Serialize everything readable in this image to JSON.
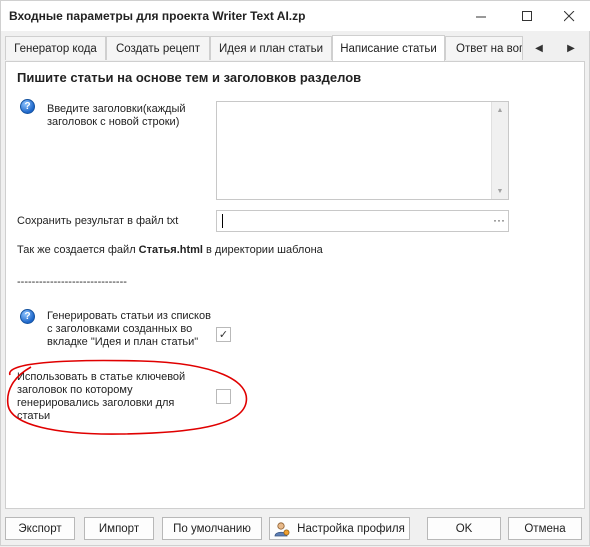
{
  "window": {
    "title": "Входные параметры для проекта Writer Text AI.zp",
    "minimize": "—",
    "maximize": "☐",
    "close": "✕"
  },
  "tabs": [
    {
      "label": "Генератор кода"
    },
    {
      "label": "Создать рецепт"
    },
    {
      "label": "Идея и план статьи"
    },
    {
      "label": "Написание статьи"
    },
    {
      "label": "Ответ на воп"
    }
  ],
  "tab_nav": {
    "prev": "◀",
    "next": "▶"
  },
  "content": {
    "heading": "Пишите статьи на основе тем и заголовков разделов",
    "headings_label": "Введите заголовки(каждый заголовок с новой строки)",
    "save_label": "Сохранить результат в файл txt",
    "save_value": "",
    "browse": "···",
    "note_prefix": "Так же создается файл ",
    "note_bold": "Статья.html",
    "note_suffix": " в директории шаблона",
    "separator": "------------------------------",
    "generate_label": "Генерировать статьи из списков с заголовками созданных во вкладке \"Идея и план статьи\"",
    "generate_checked": true,
    "keyword_label": "Использовать в статье ключевой заголовок по которому генерировались заголовки для статьи",
    "keyword_checked": false,
    "help_icon": "?"
  },
  "footer": {
    "export": "Экспорт",
    "import": "Импорт",
    "defaults": "По умолчанию",
    "profile": "Настройка профиля",
    "ok": "OK",
    "cancel": "Отмена"
  },
  "colors": {
    "annotation": "#e00000",
    "help_icon": "#1d66c9"
  }
}
